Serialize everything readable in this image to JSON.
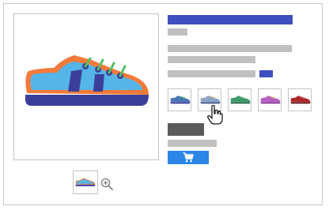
{
  "product": {
    "title": "",
    "subtitle": "",
    "description_lines": [
      "",
      "",
      ""
    ],
    "price": "",
    "stock": ""
  },
  "gallery": {
    "main_image_icon": "sneaker-icon",
    "zoom_icon": "zoom-in-icon"
  },
  "variants": [
    {
      "name": "variant-1",
      "color": "#4a78b5",
      "selected": false
    },
    {
      "name": "variant-2",
      "color": "#8aa3c9",
      "selected": true
    },
    {
      "name": "variant-3",
      "color": "#3c9a6a",
      "selected": false
    },
    {
      "name": "variant-4",
      "color": "#b65fc4",
      "selected": false
    },
    {
      "name": "variant-5",
      "color": "#b0272b",
      "selected": false
    }
  ],
  "cart": {
    "icon": "cart-icon",
    "color": "#2b86e6"
  },
  "colors": {
    "accent": "#3f4fbf",
    "placeholder": "#c0c0c0",
    "price": "#5b5b5b"
  }
}
